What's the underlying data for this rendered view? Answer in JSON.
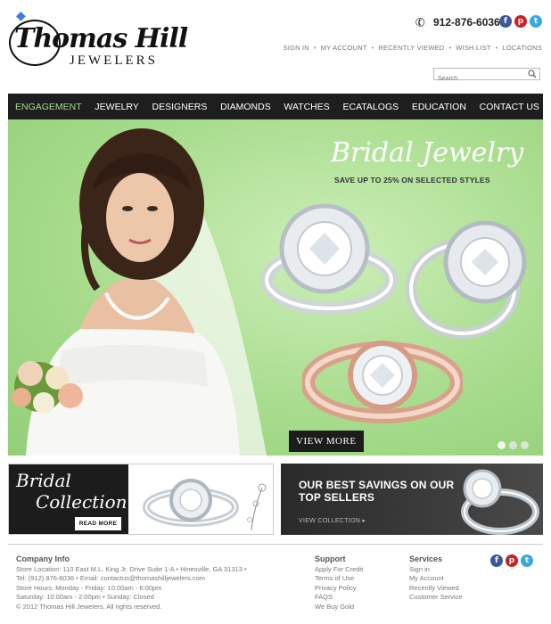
{
  "brand": {
    "name": "Thomas Hill",
    "sub": "JEWELERS"
  },
  "header": {
    "phone": "912-876-6036",
    "social": [
      "facebook-icon",
      "pinterest-icon",
      "twitter-icon"
    ],
    "links": [
      "SIGN IN",
      "MY ACCOUNT",
      "RECENTLY VIEWED",
      "WISH LIST",
      "LOCATIONS"
    ],
    "search_placeholder": "Search"
  },
  "nav": [
    "ENGAGEMENT",
    "JEWELRY",
    "DESIGNERS",
    "DIAMONDS",
    "WATCHES",
    "ECATALOGS",
    "EDUCATION",
    "CONTACT US"
  ],
  "hero": {
    "title": "Bridal Jewelry",
    "subtitle": "SAVE UP TO 25% ON SELECTED STYLES",
    "button": "VIEW MORE",
    "slides": 3,
    "active_slide": 1
  },
  "promo_left": {
    "title1": "Bridal",
    "title2": "Collection",
    "button": "READ MORE"
  },
  "promo_right": {
    "title1": "OUR BEST SAVINGS ON OUR",
    "title2": "TOP SELLERS",
    "link": "VIEW COLLECTION"
  },
  "footer": {
    "company": {
      "heading": "Company Info",
      "lines": [
        "Store Location: 110 East M.L. King Jr. Drive Suite 1-A • Hinesville,  GA  31313 •",
        "Tel: (912) 876-6036 • Email: contactus@thomashilljewelers.com",
        "Store Hours: Monday - Friday: 10:00am - 6:00pm",
        "Saturday: 10:00am - 2:00pm • Sunday: Closed",
        "© 2012 Thomas Hill Jewelers, All rights reserved."
      ]
    },
    "support": {
      "heading": "Support",
      "links": [
        "Apply For Credit",
        "Terms of Use",
        "Privacy Policy",
        "FAQS",
        "We Buy Gold"
      ]
    },
    "services": {
      "heading": "Services",
      "links": [
        "Sign in",
        "My Account",
        "Recently Viewed",
        "Customer Service"
      ]
    }
  },
  "colors": {
    "nav_bg": "#1e1e1e",
    "nav_active": "#a8d98f",
    "hero_bg": "#a7dc8d",
    "dark_panel": "#1c1c1c"
  }
}
